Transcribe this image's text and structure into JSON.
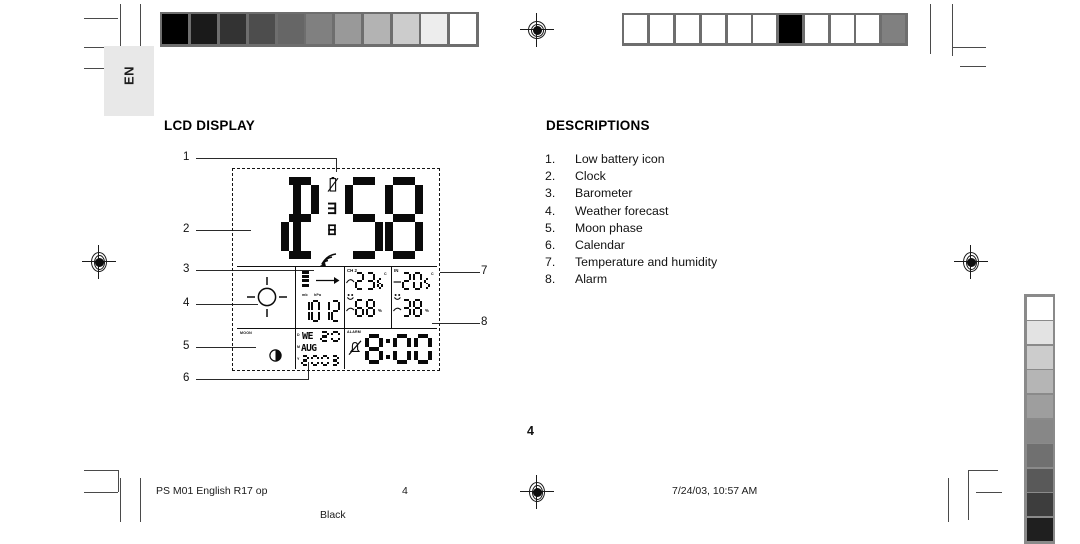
{
  "page": {
    "language_tab": "EN",
    "page_number_body": "4",
    "background": "#ffffff"
  },
  "sections": {
    "lcd_display_title": "LCD DISPLAY",
    "descriptions_title": "DESCRIPTIONS"
  },
  "descriptions": [
    {
      "num": "1.",
      "label": "Low battery icon"
    },
    {
      "num": "2.",
      "label": "Clock"
    },
    {
      "num": "3.",
      "label": "Barometer"
    },
    {
      "num": "4.",
      "label": "Weather forecast"
    },
    {
      "num": "5.",
      "label": "Moon phase"
    },
    {
      "num": "6.",
      "label": "Calendar"
    },
    {
      "num": "7.",
      "label": "Temperature and humidity"
    },
    {
      "num": "8.",
      "label": "Alarm"
    }
  ],
  "callouts": {
    "c1": "1",
    "c2": "2",
    "c3": "3",
    "c4": "4",
    "c5": "5",
    "c6": "6",
    "c7": "7",
    "c8": "8"
  },
  "lcd": {
    "clock_time": "1258",
    "clock_digits": [
      "1",
      "2",
      "5",
      "8"
    ],
    "battery_icon": "low-battery",
    "signal_icon": "wave-signal",
    "barometer": {
      "value": "1012",
      "unit_mb": "mb",
      "unit_hpa": "hPa",
      "history_bar": "0",
      "trend": "steady-arrow"
    },
    "weather_forecast_icon": "sunny",
    "channel_outdoor": {
      "label": "CH 2",
      "temperature": "23.6",
      "temp_unit": "C",
      "humidity": "68",
      "humidity_unit": "%",
      "comfort_icon": "smiley-face"
    },
    "channel_indoor": {
      "label": "IN",
      "temperature": "20.5",
      "temp_unit": "C",
      "humidity": "38",
      "humidity_unit": "%",
      "comfort_icon": "smiley-face"
    },
    "calendar": {
      "weekday": "WE",
      "day": "20",
      "month": "AUG",
      "year": "2003",
      "d_label": "D",
      "m_label": "M",
      "y_label": "Y"
    },
    "moon_phase_icon": "half-moon",
    "moon_label": "MOON",
    "alarm": {
      "label": "ALARM",
      "time": "8:00",
      "icon": "alarm-off-bell"
    }
  },
  "footer": {
    "job_name": "PS M01 English R17 op",
    "page": "4",
    "plate": "Black",
    "timestamp": "7/24/03, 10:57 AM"
  },
  "prepress": {
    "top_left_wedge": [
      "#000000",
      "#1a1a1a",
      "#333333",
      "#4d4d4d",
      "#666666",
      "#808080",
      "#999999",
      "#b3b3b3",
      "#cccccc",
      "#ededed",
      "#ffffff"
    ],
    "top_right_wedge": [
      "#ffffff",
      "#ffffff",
      "#ffffff",
      "#ffffff",
      "#ffffff",
      "#ffffff",
      "#000000",
      "#ffffff",
      "#ffffff",
      "#ffffff",
      "#808080"
    ],
    "right_vertical_wedge": [
      "#ffffff",
      "#e3e3e3",
      "#cccccc",
      "#b5b5b5",
      "#9e9e9e",
      "#878787",
      "#707070",
      "#595959",
      "#3d3d3d",
      "#1f1f1f"
    ]
  }
}
